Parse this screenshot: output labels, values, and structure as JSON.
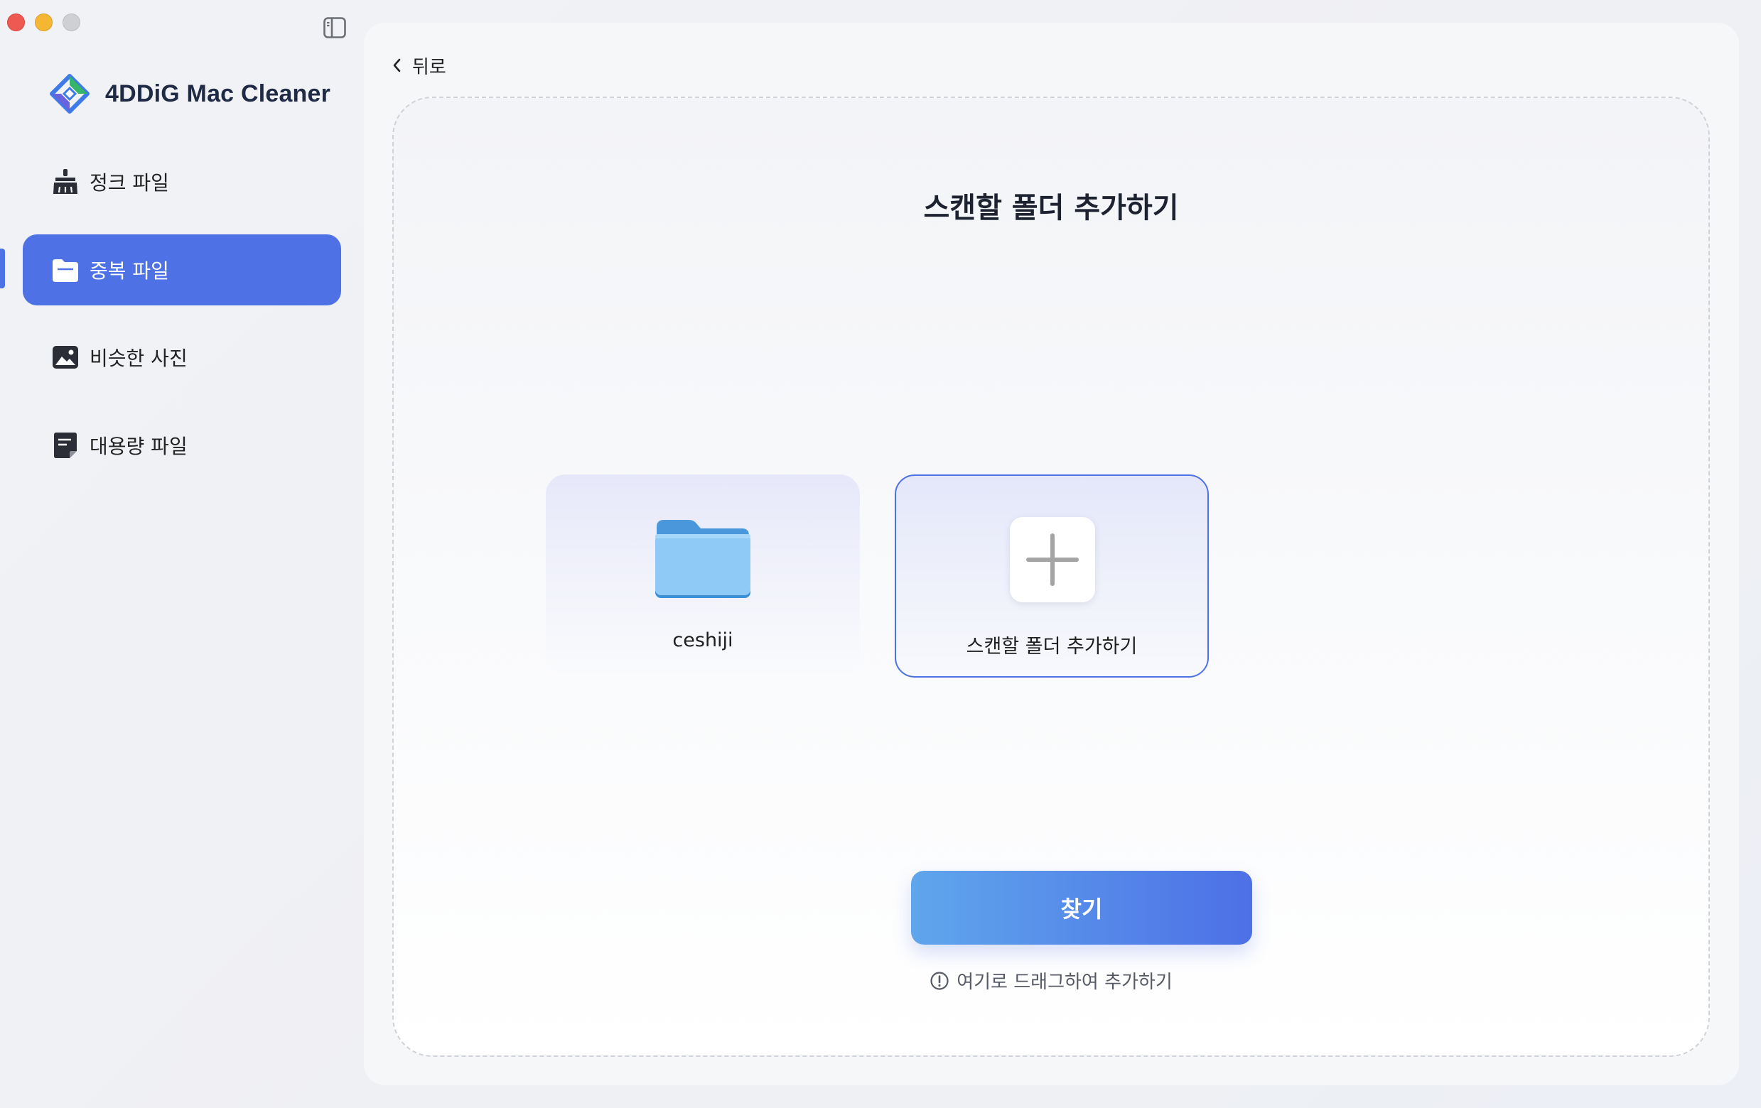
{
  "app": {
    "name": "4DDiG Mac Cleaner",
    "accent_color": "#4e72e6"
  },
  "window_controls": {
    "close_color": "#ee5a52",
    "minimize_color": "#f4b633",
    "zoom_color": "#cfd0d3"
  },
  "sidebar": {
    "items": [
      {
        "label": "정크 파일",
        "icon": "broom-icon",
        "active": false
      },
      {
        "label": "중복 파일",
        "icon": "folder-icon",
        "active": true
      },
      {
        "label": "비슷한 사진",
        "icon": "photo-icon",
        "active": false
      },
      {
        "label": "대용량 파일",
        "icon": "document-icon",
        "active": false
      }
    ]
  },
  "main": {
    "back_label": "뒤로",
    "title": "스캔할 폴더 추가하기",
    "folders": [
      {
        "name": "ceshiji",
        "icon": "folder-icon"
      }
    ],
    "add_folder_label": "스캔할 폴더 추가하기",
    "search_button": "찾기",
    "hint": "여기로 드래그하여 추가하기"
  }
}
